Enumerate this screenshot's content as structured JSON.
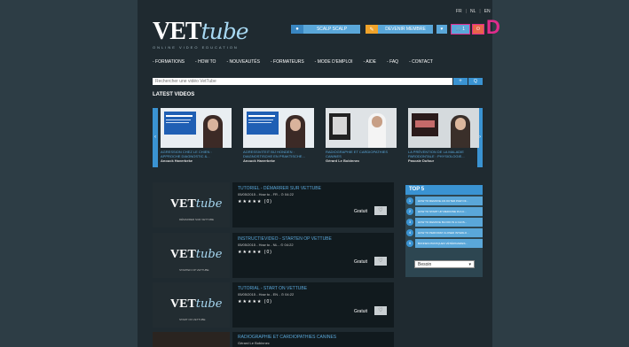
{
  "languages": [
    "FR",
    "NL",
    "EN"
  ],
  "logo": {
    "main": "VET",
    "script": "tube",
    "tagline": "ONLINE VIDEO EDUCATION"
  },
  "header": {
    "scalp_label": "SCALP SCALP",
    "member_label": "DEVENIR MEMBRE",
    "cart_count": "1",
    "annotation_letter": "D"
  },
  "nav": [
    "- FORMATIONS",
    "- HOW TO",
    "- NOUVEAUTÉS",
    "- FORMATEURS",
    "- MODE D'EMPLOI",
    "- AIDE",
    "- FAQ",
    "- CONTACT"
  ],
  "search": {
    "placeholder": "Rechercher une vidéo VetTube",
    "plus": "+",
    "go": "Q"
  },
  "latest": {
    "title": "LATEST VIDEOS",
    "items": [
      {
        "title": "AGRESSION CHEZ LE CHIEN : APPROCHE DIAGNOSTIC &...",
        "author": "Anouck Haverbeke"
      },
      {
        "title": "AGRESSIVITEIT BIJ HONDEN : DIAGNOSTISCHE EN PRAKTISCHE...",
        "author": "Anouck Haverbeke"
      },
      {
        "title": "RADIOGRAPHIE ET CARDIOPATHIES CANINES",
        "author": "Gérard Le Bobinnec"
      },
      {
        "title": "LA PRÉVENTION DE LA MALADIE PARODONTALE : PHYSIOLOGIE...",
        "author": "Pascale Dufour"
      }
    ]
  },
  "videos": [
    {
      "title": "TUTORIEL - DÉMARRER SUR VETTUBE",
      "meta": "05/05/2015 - How to - FR - ⊙ 04:22",
      "stars": "★★★★★ (0)",
      "price": "Gratuit",
      "caption": "DÉMARRER SUR VETTUBE"
    },
    {
      "title": "INSTRUCTIEVIDEO - STARTEN OP VETTUBE",
      "meta": "05/05/2015 - How to - NL - ⊙ 04:22",
      "stars": "★★★★★ (0)",
      "price": "Gratuit",
      "caption": "STARTEN OP VETTUBE"
    },
    {
      "title": "TUTORIAL - START ON VETTUBE",
      "meta": "05/05/2015 - How to - EN - ⊙ 04:22",
      "stars": "★★★★★ (0)",
      "price": "Gratuit",
      "caption": "START ON VETTUBE"
    },
    {
      "title": "RADIOGRAPHIE ET CARDIOPATHIES CANINES",
      "meta": "Gérard Le Bobinnec",
      "stars": "",
      "price": "",
      "caption": ""
    }
  ],
  "top5": {
    "title": "TOP 5",
    "items": [
      {
        "num": "1",
        "label": "HOW TO REMOVE AN OUTER PAW OF..."
      },
      {
        "num": "2",
        "label": "HOW TO START UP MEDICINE IN A C..."
      },
      {
        "num": "3",
        "label": "HOW TO REMOVE BLOOD IN A CLOS..."
      },
      {
        "num": "4",
        "label": "HOW TO PERFORM CLOSED INTERLO..."
      },
      {
        "num": "5",
        "label": "BONNES PRATIQUES VÉTÉRINAIRES..."
      }
    ],
    "select_value": "Besoin"
  }
}
